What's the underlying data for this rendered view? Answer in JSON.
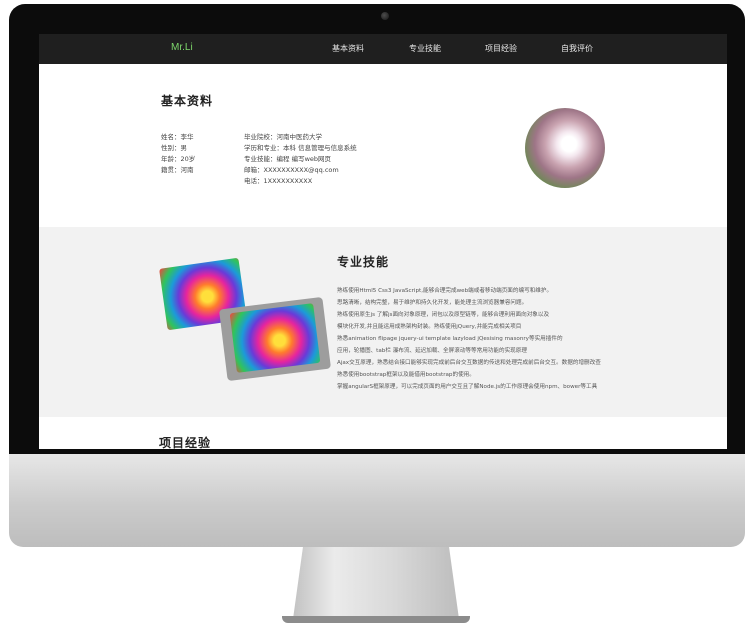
{
  "nav": {
    "brand": "Mr.Li",
    "items": [
      "基本资料",
      "专业技能",
      "项目经验",
      "自我评价"
    ]
  },
  "basic": {
    "title": "基本资料",
    "left": [
      "姓名：李华",
      "性别：男",
      "年龄：20岁",
      "籍贯：河南"
    ],
    "right": [
      "毕业院校：河南中医药大学",
      "学历和专业：本科    信息管理与信息系统",
      "专业技能：编程    编写web网页",
      "邮箱：XXXXXXXXXX@qq.com",
      "电话：1XXXXXXXXXX"
    ]
  },
  "skills": {
    "title": "专业技能",
    "lines": [
      "熟练使用Html5 Css3 JavaScript,能够合理完成web端或者移动端页面的编写和维护。",
      "思路清晰，结构完整，易于维护和持久化开发，能处理主流浏览器兼容问题。",
      "熟练使用原生js 了解js面向对象原理，闭包以及原型链等，能够合理利用面向对象以及",
      "模块化开发,并且能运用成熟架构封装。熟练使用jQuery,并能完成相关项目",
      "熟悉animation flipage jquery-ui template lazyload jQesising masonry等实用插件的",
      "应用，轮播图、tab栏 瀑布流、延迟加载、全屏滚动等等常用功能的实现原理",
      "Ajax交互原理，熟悉结合接口能够实现完成前后台交互数据的传送和处理完成前后台交互。数据的增删改查",
      "熟悉使用bootstrap框架以及能借用bootstrap的使用。",
      "掌握angularS框架原理，可以完成页面的用户交互且了解Node.js的工作原理会使用npm、bower等工具"
    ]
  },
  "projects": {
    "title": "项目经验"
  },
  "colors": {
    "brand": "#7dd66b",
    "navbar": "#1f1f1f",
    "skills_bg": "#f2f2f2"
  }
}
